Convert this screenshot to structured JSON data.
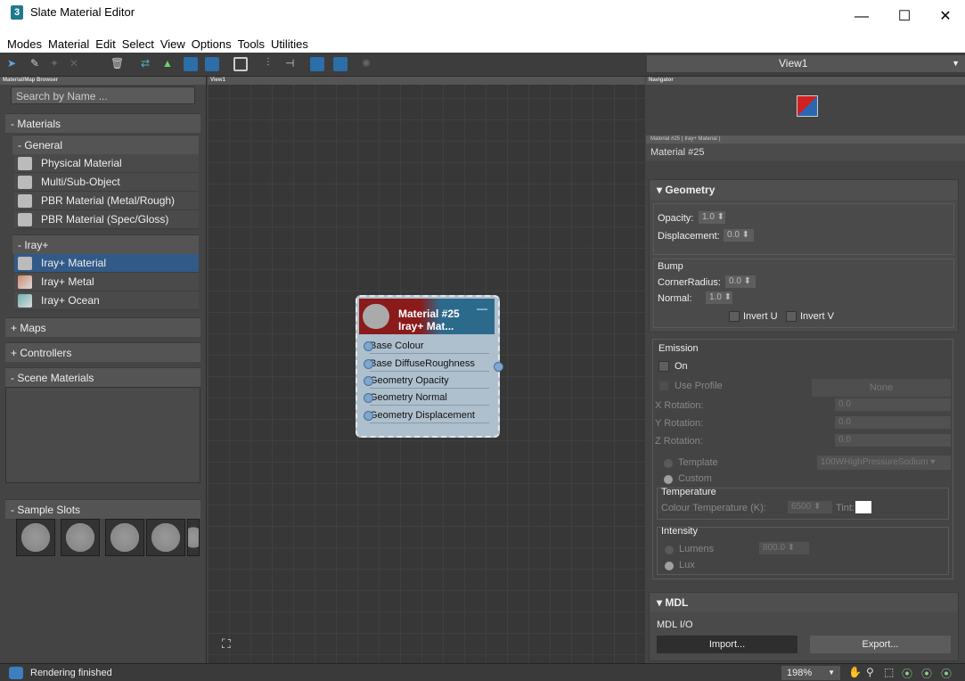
{
  "window": {
    "title": "Slate Material Editor",
    "app_icon": "3",
    "min": "—",
    "max": "☐",
    "close": "✕"
  },
  "menu": [
    "Modes",
    "Material",
    "Edit",
    "Select",
    "View",
    "Options",
    "Tools",
    "Utilities"
  ],
  "view_selector": "View1",
  "browser": {
    "title": "Material/Map Browser",
    "search_placeholder": "Search by Name ...",
    "materials": "- Materials",
    "general": "- General",
    "general_items": [
      "Physical Material",
      "Multi/Sub-Object",
      "PBR Material (Metal/Rough)",
      "PBR Material (Spec/Gloss)"
    ],
    "iray": "- Iray+",
    "iray_items": [
      "Iray+ Material",
      "Iray+ Metal",
      "Iray+ Ocean"
    ],
    "maps": "+ Maps",
    "controllers": "+ Controllers",
    "scene_materials": "- Scene Materials",
    "sample_slots": "- Sample Slots"
  },
  "viewport": {
    "title": "View1",
    "node": {
      "title": "Material #25",
      "subtitle": "Iray+ Mat...",
      "minimize": "—",
      "slots": [
        "Base Colour",
        "Base DiffuseRoughness",
        "Geometry Opacity",
        "Geometry Normal",
        "Geometry Displacement"
      ]
    }
  },
  "navigator": {
    "title": "Navigator"
  },
  "properties": {
    "header": "Material #25 ( Iray+ Material )",
    "name": "Material #25",
    "geometry": {
      "title": "Geometry",
      "opacity_label": "Opacity:",
      "opacity": "1.0",
      "displacement_label": "Displacement:",
      "displacement": "0.0",
      "bump_label": "Bump",
      "corner_label": "CornerRadius:",
      "corner": "0.0",
      "normal_label": "Normal:",
      "normal": "1.0",
      "invert_u": "Invert U",
      "invert_v": "Invert V"
    },
    "emission": {
      "title": "Emission",
      "on": "On",
      "use_profile": "Use Profile",
      "profile_value": "None",
      "x_rotation": "X Rotation:",
      "x_val": "0.0",
      "y_rotation": "Y Rotation:",
      "y_val": "0.0",
      "z_rotation": "Z Rotation:",
      "z_val": "0.0",
      "template": "Template",
      "template_value": "100WHighPressureSodium",
      "custom": "Custom",
      "temperature_title": "Temperature",
      "colour_temp_label": "Colour Temperature (K):",
      "colour_temp": "6500",
      "tint_label": "Tint:",
      "intensity_title": "Intensity",
      "lumens": "Lumens",
      "lumens_value": "800.0",
      "lux": "Lux"
    },
    "mdl": {
      "title": "MDL",
      "io_label": "MDL I/O",
      "import": "Import...",
      "export": "Export..."
    }
  },
  "status": {
    "text": "Rendering finished",
    "zoom": "198%"
  },
  "colors": {
    "selected": "#325a88",
    "node_red": "#8b1a1a",
    "node_blue": "#2c6a8c"
  }
}
